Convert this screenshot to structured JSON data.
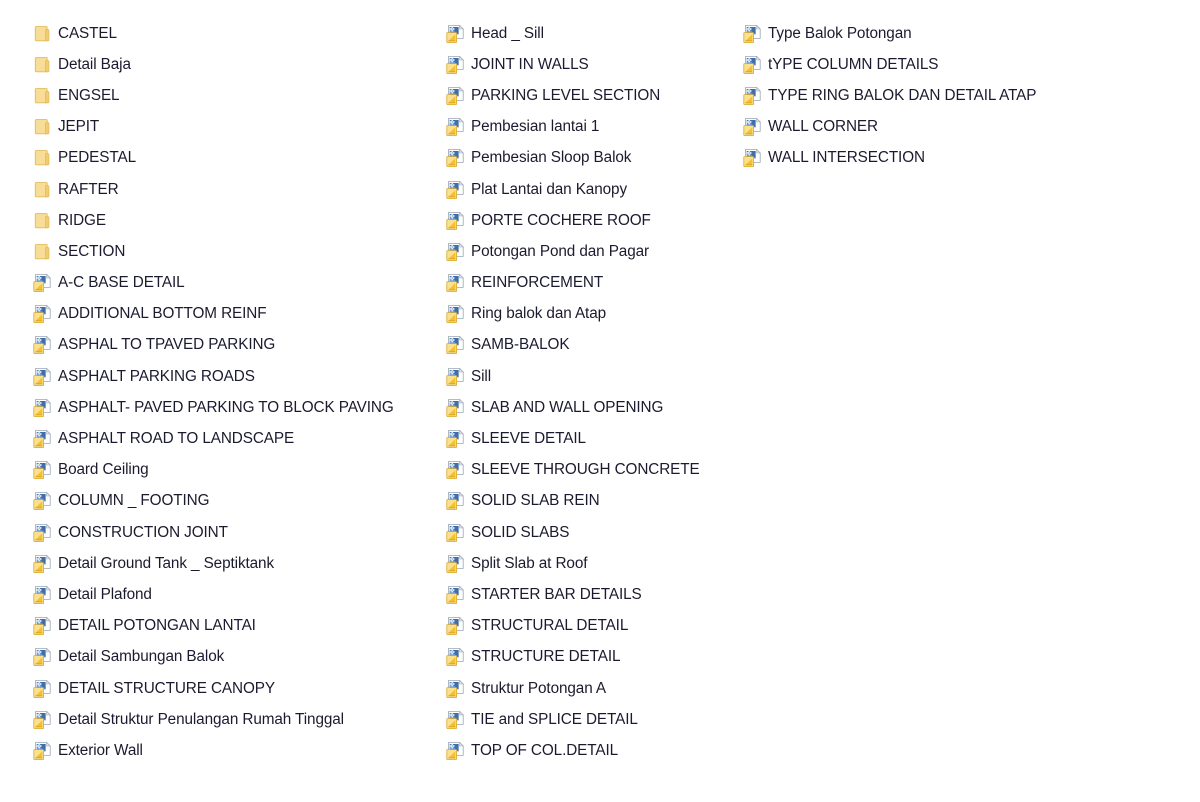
{
  "view": {
    "name": "file-explorer-list",
    "background_color": "#ffffff",
    "text_color": "#1b1b2f",
    "folder_icon_color": "#f5d98a",
    "folder_icon_border_color": "#e0b94e",
    "dwg_icon_paper_color": "#ffffff",
    "dwg_icon_blue_color": "#4a79b5",
    "dwg_icon_yellow_color": "#f5c53d",
    "icon_names": {
      "folder": "folder-icon",
      "dwg": "dwg-file-icon"
    }
  },
  "columns": [
    {
      "name": "column-1",
      "items": [
        {
          "label": "CASTEL",
          "icon": "folder"
        },
        {
          "label": "Detail Baja",
          "icon": "folder"
        },
        {
          "label": "ENGSEL",
          "icon": "folder"
        },
        {
          "label": "JEPIT",
          "icon": "folder"
        },
        {
          "label": "PEDESTAL",
          "icon": "folder"
        },
        {
          "label": "RAFTER",
          "icon": "folder"
        },
        {
          "label": "RIDGE",
          "icon": "folder"
        },
        {
          "label": "SECTION",
          "icon": "folder"
        },
        {
          "label": "A-C BASE DETAIL",
          "icon": "dwg"
        },
        {
          "label": "ADDITIONAL BOTTOM REINF",
          "icon": "dwg"
        },
        {
          "label": "ASPHAL TO TPAVED PARKING",
          "icon": "dwg"
        },
        {
          "label": "ASPHALT PARKING ROADS",
          "icon": "dwg"
        },
        {
          "label": "ASPHALT- PAVED PARKING TO BLOCK PAVING",
          "icon": "dwg"
        },
        {
          "label": "ASPHALT ROAD TO LANDSCAPE",
          "icon": "dwg"
        },
        {
          "label": "Board Ceiling",
          "icon": "dwg"
        },
        {
          "label": "COLUMN _ FOOTING",
          "icon": "dwg"
        },
        {
          "label": "CONSTRUCTION JOINT",
          "icon": "dwg"
        },
        {
          "label": "Detail Ground Tank _ Septiktank",
          "icon": "dwg"
        },
        {
          "label": "Detail Plafond",
          "icon": "dwg"
        },
        {
          "label": "DETAIL POTONGAN LANTAI",
          "icon": "dwg"
        },
        {
          "label": "Detail Sambungan Balok",
          "icon": "dwg"
        },
        {
          "label": "DETAIL STRUCTURE CANOPY",
          "icon": "dwg"
        },
        {
          "label": "Detail Struktur Penulangan Rumah Tinggal",
          "icon": "dwg"
        },
        {
          "label": "Exterior Wall",
          "icon": "dwg"
        }
      ]
    },
    {
      "name": "column-2",
      "items": [
        {
          "label": "Head _ Sill",
          "icon": "dwg"
        },
        {
          "label": "JOINT IN WALLS",
          "icon": "dwg"
        },
        {
          "label": "PARKING LEVEL SECTION",
          "icon": "dwg"
        },
        {
          "label": "Pembesian lantai 1",
          "icon": "dwg"
        },
        {
          "label": "Pembesian Sloop Balok",
          "icon": "dwg"
        },
        {
          "label": "Plat Lantai dan Kanopy",
          "icon": "dwg"
        },
        {
          "label": "PORTE COCHERE ROOF",
          "icon": "dwg"
        },
        {
          "label": "Potongan Pond dan Pagar",
          "icon": "dwg"
        },
        {
          "label": "REINFORCEMENT",
          "icon": "dwg"
        },
        {
          "label": "Ring balok dan Atap",
          "icon": "dwg"
        },
        {
          "label": "SAMB-BALOK",
          "icon": "dwg"
        },
        {
          "label": "Sill",
          "icon": "dwg"
        },
        {
          "label": "SLAB AND WALL OPENING",
          "icon": "dwg"
        },
        {
          "label": "SLEEVE DETAIL",
          "icon": "dwg"
        },
        {
          "label": "SLEEVE THROUGH CONCRETE",
          "icon": "dwg"
        },
        {
          "label": "SOLID SLAB REIN",
          "icon": "dwg"
        },
        {
          "label": "SOLID SLABS",
          "icon": "dwg"
        },
        {
          "label": "Split Slab at Roof",
          "icon": "dwg"
        },
        {
          "label": "STARTER BAR DETAILS",
          "icon": "dwg"
        },
        {
          "label": "STRUCTURAL DETAIL",
          "icon": "dwg"
        },
        {
          "label": "STRUCTURE DETAIL",
          "icon": "dwg"
        },
        {
          "label": "Struktur Potongan A",
          "icon": "dwg"
        },
        {
          "label": "TIE and SPLICE DETAIL",
          "icon": "dwg"
        },
        {
          "label": "TOP OF COL.DETAIL",
          "icon": "dwg"
        }
      ]
    },
    {
      "name": "column-3",
      "items": [
        {
          "label": "Type Balok Potongan",
          "icon": "dwg"
        },
        {
          "label": "tYPE COLUMN DETAILS",
          "icon": "dwg"
        },
        {
          "label": "TYPE RING BALOK DAN DETAIL ATAP",
          "icon": "dwg"
        },
        {
          "label": "WALL CORNER",
          "icon": "dwg"
        },
        {
          "label": "WALL INTERSECTION",
          "icon": "dwg"
        }
      ]
    }
  ]
}
